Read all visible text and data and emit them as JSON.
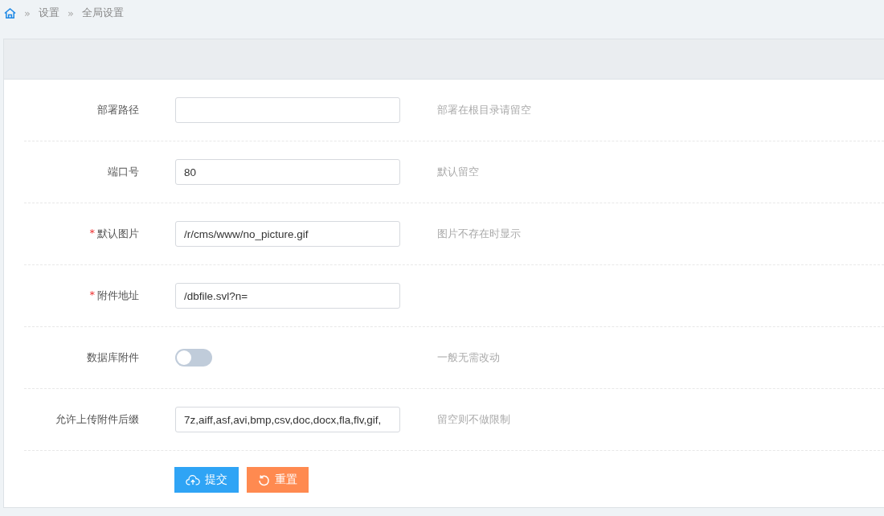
{
  "breadcrumb": [
    {
      "separator": "»",
      "label": "设置"
    },
    {
      "separator": "»",
      "label": "全局设置"
    }
  ],
  "fields": [
    {
      "kind": "text",
      "label": "部署路径",
      "hint": "部署在根目录请留空"
    },
    {
      "kind": "text",
      "label": "端口号",
      "value": "80",
      "hint": "默认留空"
    },
    {
      "kind": "text",
      "label": "默认图片",
      "required_mark": "*",
      "value": "/r/cms/www/no_picture.gif",
      "hint": "图片不存在时显示"
    },
    {
      "kind": "text",
      "label": "附件地址",
      "required_mark": "*",
      "value": "/dbfile.svl?n="
    },
    {
      "kind": "switch",
      "label": "数据库附件",
      "on": false,
      "hint": "一般无需改动"
    },
    {
      "kind": "text",
      "label": "允许上传附件后缀",
      "value": "7z,aiff,asf,avi,bmp,csv,doc,docx,fla,flv,gif,",
      "hint": "留空则不做限制"
    }
  ],
  "buttons": [
    {
      "kind": "submit",
      "label": "提交"
    },
    {
      "kind": "reset",
      "label": "重置"
    }
  ]
}
